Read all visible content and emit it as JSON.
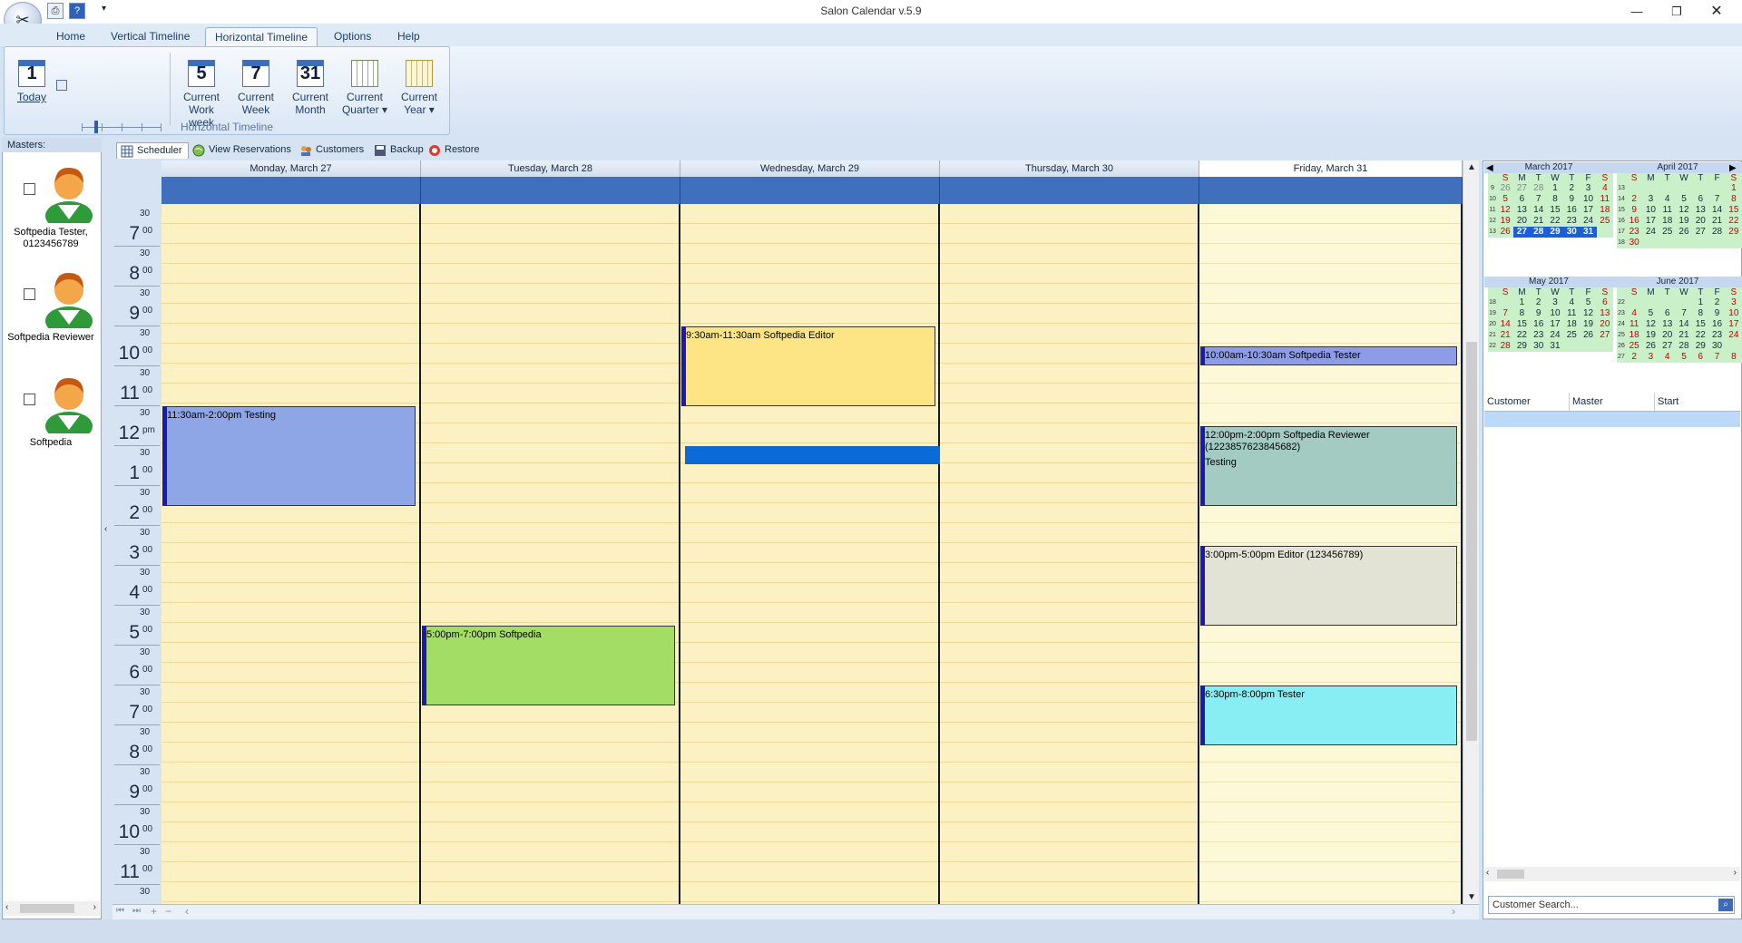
{
  "window": {
    "title": "Salon Calendar v.5.9"
  },
  "ribbon_tabs": [
    "Home",
    "Vertical Timeline",
    "Horizontal Timeline",
    "Options",
    "Help"
  ],
  "ribbon": {
    "today": {
      "num": "1",
      "label": "Today"
    },
    "work_week": {
      "num": "5",
      "label1": "Current",
      "label2": "Work week"
    },
    "week": {
      "num": "7",
      "label1": "Current",
      "label2": "Week"
    },
    "month": {
      "num": "31",
      "label1": "Current",
      "label2": "Month"
    },
    "quarter": {
      "label1": "Current",
      "label2": "Quarter"
    },
    "year": {
      "label1": "Current",
      "label2": "Year"
    },
    "group_label": "Horizontal Timeline"
  },
  "masters": {
    "header": "Masters:",
    "items": [
      {
        "name": "Softpedia Tester, 0123456789"
      },
      {
        "name": "Softpedia Reviewer"
      },
      {
        "name": "Softpedia"
      }
    ]
  },
  "view_tabs": [
    "Scheduler",
    "View Reservations",
    "Customers",
    "Backup",
    "Restore"
  ],
  "days": [
    "Monday, March 27",
    "Tuesday, March 28",
    "Wednesday, March 29",
    "Thursday, March 30",
    "Friday, March 31"
  ],
  "hours": [
    {
      "h": "7",
      "s": "00"
    },
    {
      "h": "8",
      "s": "00"
    },
    {
      "h": "9",
      "s": "00"
    },
    {
      "h": "10",
      "s": "00"
    },
    {
      "h": "11",
      "s": "00"
    },
    {
      "h": "12",
      "s": "pm"
    },
    {
      "h": "1",
      "s": "00"
    },
    {
      "h": "2",
      "s": "00"
    },
    {
      "h": "3",
      "s": "00"
    },
    {
      "h": "4",
      "s": "00"
    },
    {
      "h": "5",
      "s": "00"
    },
    {
      "h": "6",
      "s": "00"
    },
    {
      "h": "7",
      "s": "00"
    },
    {
      "h": "8",
      "s": "00"
    },
    {
      "h": "9",
      "s": "00"
    },
    {
      "h": "10",
      "s": "00"
    },
    {
      "h": "11",
      "s": "00"
    }
  ],
  "half_label": "30",
  "appointments": [
    {
      "text": "11:30am-2:00pm Testing",
      "color": "#8ea6e6"
    },
    {
      "text": "5:00pm-7:00pm Softpedia",
      "color": "#a4dd66"
    },
    {
      "text": "9:30am-11:30am Softpedia Editor",
      "color": "#fde585"
    },
    {
      "text": "10:00am-10:30am Softpedia Tester",
      "color": "#8c9ce9"
    },
    {
      "text": "12:00pm-2:00pm Softpedia Reviewer (1223857623845682)",
      "note": "Testing",
      "color": "#a3cbc2"
    },
    {
      "text": "3:00pm-5:00pm Editor (123456789)",
      "color": "#e2e3d4"
    },
    {
      "text": "6:30pm-8:00pm Tester",
      "color": "#88eef4"
    }
  ],
  "mini_calendars": [
    {
      "title": "March 2017",
      "weeks": [
        [
          "9",
          "26",
          "27",
          "28",
          "1",
          "2",
          "3",
          "4"
        ],
        [
          "10",
          "5",
          "6",
          "7",
          "8",
          "9",
          "10",
          "11"
        ],
        [
          "11",
          "12",
          "13",
          "14",
          "15",
          "16",
          "17",
          "18"
        ],
        [
          "12",
          "19",
          "20",
          "21",
          "22",
          "23",
          "24",
          "25"
        ],
        [
          "13",
          "26",
          "27",
          "28",
          "29",
          "30",
          "31",
          ""
        ]
      ]
    },
    {
      "title": "April 2017",
      "weeks": [
        [
          "13",
          "",
          "",
          "",
          "",
          "",
          "",
          "1"
        ],
        [
          "14",
          "2",
          "3",
          "4",
          "5",
          "6",
          "7",
          "8"
        ],
        [
          "15",
          "9",
          "10",
          "11",
          "12",
          "13",
          "14",
          "15"
        ],
        [
          "16",
          "16",
          "17",
          "18",
          "19",
          "20",
          "21",
          "22"
        ],
        [
          "17",
          "23",
          "24",
          "25",
          "26",
          "27",
          "28",
          "29"
        ],
        [
          "18",
          "30",
          "",
          "",
          "",
          "",
          "",
          ""
        ]
      ]
    },
    {
      "title": "May 2017",
      "weeks": [
        [
          "18",
          "",
          "1",
          "2",
          "3",
          "4",
          "5",
          "6"
        ],
        [
          "19",
          "7",
          "8",
          "9",
          "10",
          "11",
          "12",
          "13"
        ],
        [
          "20",
          "14",
          "15",
          "16",
          "17",
          "18",
          "19",
          "20"
        ],
        [
          "21",
          "21",
          "22",
          "23",
          "24",
          "25",
          "26",
          "27"
        ],
        [
          "22",
          "28",
          "29",
          "30",
          "31",
          "",
          "",
          ""
        ]
      ]
    },
    {
      "title": "June 2017",
      "weeks": [
        [
          "22",
          "",
          "",
          "",
          "",
          "1",
          "2",
          "3"
        ],
        [
          "23",
          "4",
          "5",
          "6",
          "7",
          "8",
          "9",
          "10"
        ],
        [
          "24",
          "11",
          "12",
          "13",
          "14",
          "15",
          "16",
          "17"
        ],
        [
          "25",
          "18",
          "19",
          "20",
          "21",
          "22",
          "23",
          "24"
        ],
        [
          "26",
          "25",
          "26",
          "27",
          "28",
          "29",
          "30",
          ""
        ],
        [
          "27",
          "2",
          "3",
          "4",
          "5",
          "6",
          "7",
          "8"
        ]
      ]
    }
  ],
  "weekday_headers": [
    "S",
    "M",
    "T",
    "W",
    "T",
    "F",
    "S"
  ],
  "customer_grid": {
    "columns": [
      "Customer",
      "Master",
      "Start"
    ]
  },
  "customer_search": {
    "placeholder": "Customer Search..."
  }
}
